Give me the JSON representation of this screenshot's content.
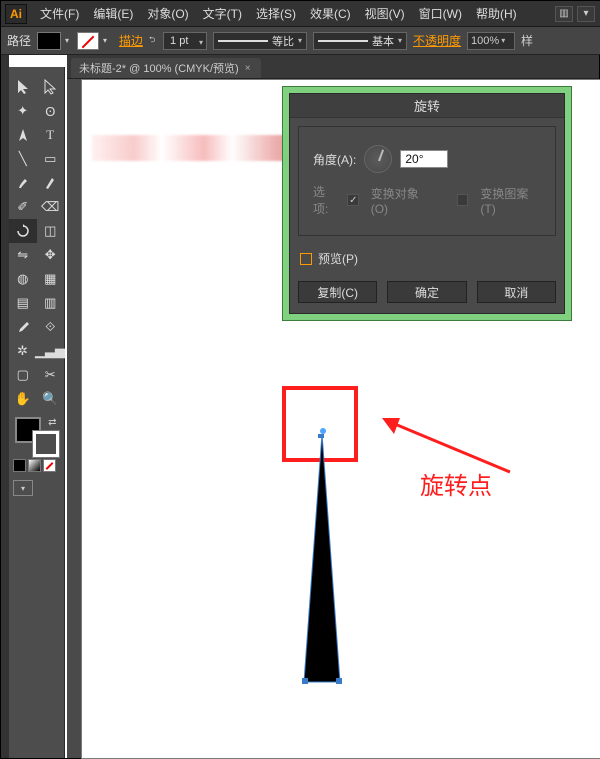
{
  "menubar": {
    "items": [
      "文件(F)",
      "编辑(E)",
      "对象(O)",
      "文字(T)",
      "选择(S)",
      "效果(C)",
      "视图(V)",
      "窗口(W)",
      "帮助(H)"
    ]
  },
  "ctrlbar": {
    "path_label": "路径",
    "stroke_label": "描边",
    "stroke_weight": "1 pt",
    "profile_uniform_label": "等比",
    "profile_basic_label": "基本",
    "opacity_label": "不透明度",
    "opacity_value": "100%",
    "sample_label": "样"
  },
  "tab": {
    "title": "未标题-2* @ 100% (CMYK/预览)"
  },
  "dialog": {
    "title": "旋转",
    "angle_label": "角度(A):",
    "angle_value": "20°",
    "options_label": "选项:",
    "transform_objects_label": "变换对象(O)",
    "transform_patterns_label": "变换图案(T)",
    "preview_label": "预览(P)",
    "copy_btn": "复制(C)",
    "ok_btn": "确定",
    "cancel_btn": "取消"
  },
  "annotation": {
    "label": "旋转点"
  }
}
